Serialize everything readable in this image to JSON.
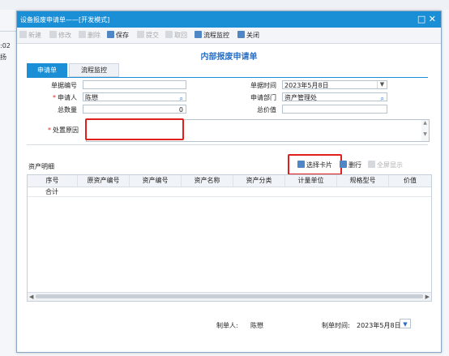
{
  "background": {
    "fragment_text": ":02 扬"
  },
  "window": {
    "title": "设备报废申请单——[开发模式]",
    "close_glyph": "□ ✕"
  },
  "toolbar": {
    "new_label": "新建",
    "edit_label": "修改",
    "delete_label": "删除",
    "save_label": "保存",
    "submit_label": "提交",
    "recall_label": "取回",
    "process_monitor_label": "流程监控",
    "close_label": "关闭"
  },
  "page": {
    "title": "内部报废申请单"
  },
  "tabs": {
    "tab1": "申请单",
    "tab2": "流程监控"
  },
  "form": {
    "doc_no_label": "单据编号",
    "doc_no_value": "",
    "doc_time_label": "单据时间",
    "doc_time_value": "2023年5月8日",
    "applicant_label": "申请人",
    "applicant_value": "陈懋",
    "dept_label": "申请部门",
    "dept_value": "资产管理处",
    "total_qty_label": "总数量",
    "total_qty_value": "0",
    "total_value_label": "总价值",
    "total_value_value": "",
    "reason_label": "处置原因",
    "reason_value": ""
  },
  "assets": {
    "section_title": "资产明细",
    "select_card_label": "选择卡片",
    "delete_row_label": "删行",
    "fullscreen_label": "全屏显示",
    "columns": [
      "序号",
      "原资产编号",
      "资产编号",
      "资产名称",
      "资产分类",
      "计量单位",
      "规格型号",
      "价值"
    ],
    "total_row_label": "合计"
  },
  "footer": {
    "maker_label": "制单人:",
    "maker_value": "陈懋",
    "make_time_label": "制单时间:",
    "make_time_value": "2023年5月8日"
  },
  "colors": {
    "accent": "#1a8fd6",
    "title_blue": "#2a6fc4",
    "highlight_red": "#e0201d",
    "required_red": "#e02020"
  }
}
